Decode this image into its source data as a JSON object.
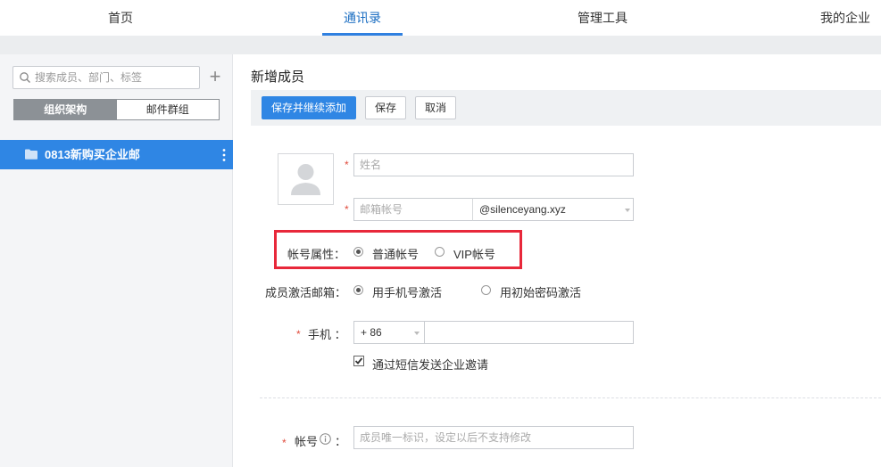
{
  "nav": {
    "tabs": [
      {
        "label": "首页"
      },
      {
        "label": "通讯录"
      },
      {
        "label": "管理工具"
      },
      {
        "label": "我的企业"
      }
    ]
  },
  "sidebar": {
    "search_placeholder": "搜索成员、部门、标签",
    "plus_label": "+",
    "segments": [
      "组织架构",
      "邮件群组"
    ],
    "tree": [
      {
        "label": "0813新购买企业邮"
      }
    ]
  },
  "main": {
    "title": "新增成员",
    "toolbar": {
      "save_continue": "保存并继续添加",
      "save": "保存",
      "cancel": "取消"
    },
    "form": {
      "required_mark": "*",
      "name_placeholder": "姓名",
      "email_placeholder": "邮箱帐号",
      "domain": "@silenceyang.xyz",
      "account_type_label": "帐号属性：",
      "account_type_options": [
        "普通帐号",
        "VIP帐号"
      ],
      "activation_label": "成员激活邮箱：",
      "activation_options": [
        "用手机号激活",
        "用初始密码激活"
      ],
      "phone_label": "手机 ：",
      "phone_code": "+ 86",
      "sms_invite": "通过短信发送企业邀请",
      "account_label": "帐号",
      "account_colon": "：",
      "account_placeholder": "成员唯一标识，设定以后不支持修改"
    }
  },
  "colors": {
    "accent": "#2f86e4",
    "highlight": "#e8283a",
    "required": "#e04b3c"
  }
}
